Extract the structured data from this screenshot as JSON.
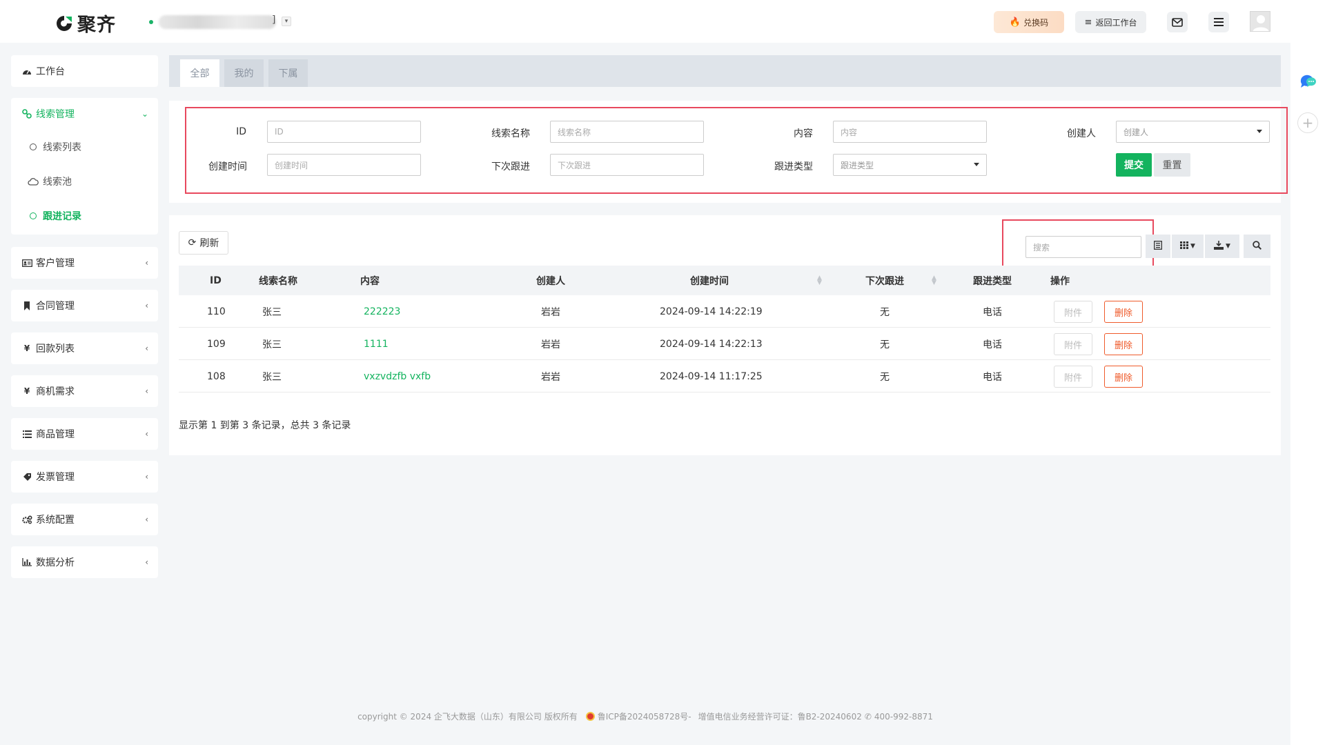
{
  "header": {
    "brand": "聚齐",
    "redeem_label": "兑换码",
    "back_label": "返回工作台",
    "name_suffix": "]",
    "name_caret": "▾"
  },
  "sidebar": {
    "workbench": "工作台",
    "leads_group": "线索管理",
    "leads_items": [
      {
        "label": "线索列表"
      },
      {
        "label": "线索池"
      },
      {
        "label": "跟进记录"
      }
    ],
    "groups": [
      {
        "label": "客户管理",
        "icon": "id-card-icon"
      },
      {
        "label": "合同管理",
        "icon": "bookmark-icon"
      },
      {
        "label": "回款列表",
        "icon": "yen-icon"
      },
      {
        "label": "商机需求",
        "icon": "yen-icon"
      },
      {
        "label": "商品管理",
        "icon": "list-icon"
      },
      {
        "label": "发票管理",
        "icon": "tag-icon"
      },
      {
        "label": "系统配置",
        "icon": "gears-icon"
      },
      {
        "label": "数据分析",
        "icon": "bar-chart-icon"
      }
    ]
  },
  "tabs": [
    {
      "label": "全部"
    },
    {
      "label": "我的"
    },
    {
      "label": "下属"
    }
  ],
  "filter": {
    "id_label": "ID",
    "id_placeholder": "ID",
    "lead_name_label": "线索名称",
    "lead_name_placeholder": "线索名称",
    "content_label": "内容",
    "content_placeholder": "内容",
    "creator_label": "创建人",
    "creator_placeholder": "创建人",
    "created_time_label": "创建时间",
    "created_time_placeholder": "创建时间",
    "next_follow_label": "下次跟进",
    "next_follow_placeholder": "下次跟进",
    "follow_type_label": "跟进类型",
    "follow_type_placeholder": "跟进类型",
    "submit_label": "提交",
    "reset_label": "重置"
  },
  "toolbar": {
    "refresh_label": "刷新",
    "search_placeholder": "搜索"
  },
  "table": {
    "headers": [
      "ID",
      "线索名称",
      "内容",
      "创建人",
      "创建时间",
      "下次跟进",
      "跟进类型",
      "操作"
    ],
    "rows": [
      {
        "id": "110",
        "name": "张三",
        "content": "222223",
        "creator": "岩岩",
        "created": "2024-09-14 14:22:19",
        "next": "无",
        "type": "电话",
        "attach": "附件",
        "delete": "删除"
      },
      {
        "id": "109",
        "name": "张三",
        "content": "1111",
        "creator": "岩岩",
        "created": "2024-09-14 14:22:13",
        "next": "无",
        "type": "电话",
        "attach": "附件",
        "delete": "删除"
      },
      {
        "id": "108",
        "name": "张三",
        "content": "vxzvdzfb vxfb",
        "creator": "岩岩",
        "created": "2024-09-14 11:17:25",
        "next": "无",
        "type": "电话",
        "attach": "附件",
        "delete": "删除"
      }
    ],
    "summary": "显示第 1 到第 3 条记录，总共 3 条记录"
  },
  "footer": {
    "copyright": "copyright © 2024 企飞大数据（山东）有限公司 版权所有",
    "icp": "鲁ICP备2024058728号-",
    "license": "增值电信业务经营许可证：鲁B2-20240602",
    "phone": "400-992-8871"
  },
  "colors": {
    "brand_green": "#13b35e",
    "danger": "#ef5a2a",
    "highlight_box": "#e8485d"
  }
}
